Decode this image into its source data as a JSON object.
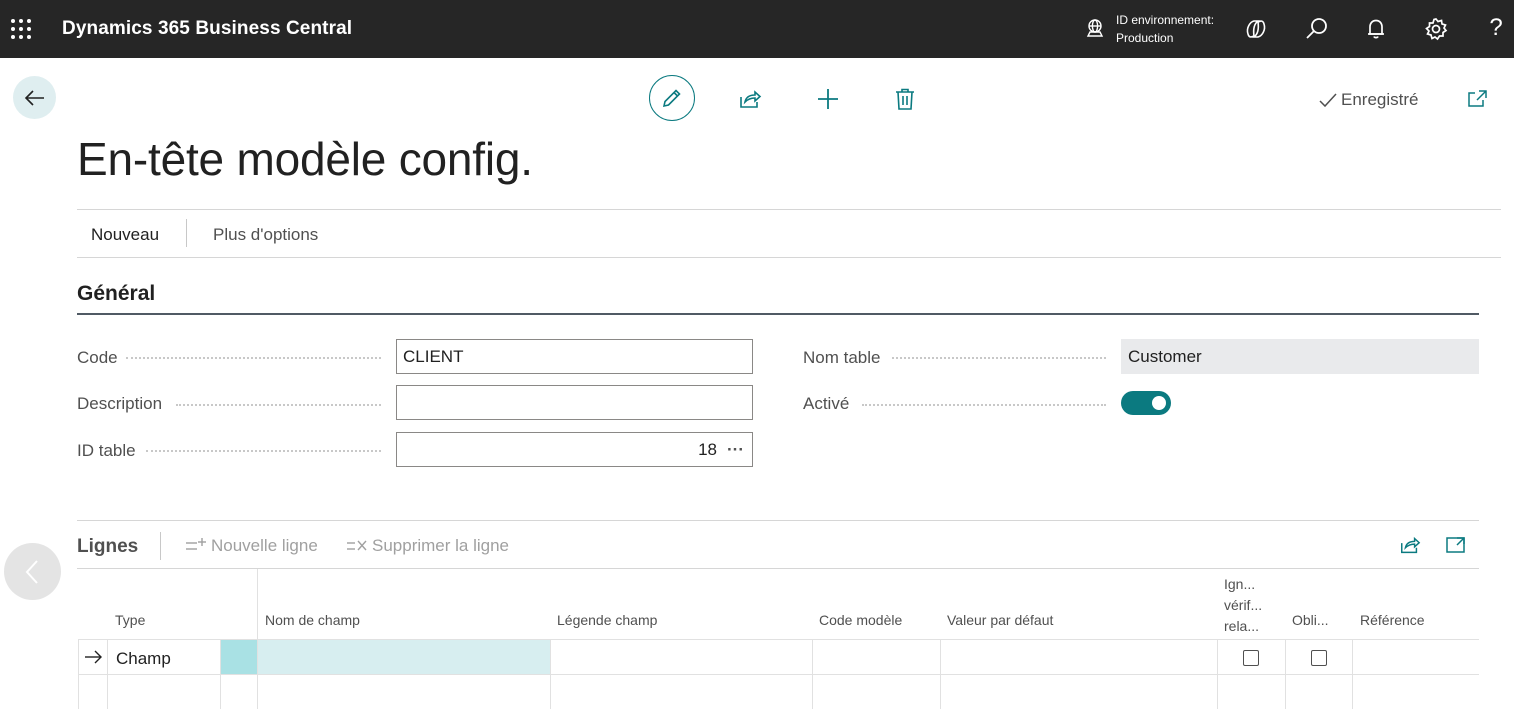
{
  "topbar": {
    "app_title": "Dynamics 365 Business Central",
    "environment_label": "ID environnement:",
    "environment_value": "Production",
    "icons": [
      "waffle-icon",
      "environment-icon",
      "copilot-icon",
      "search-icon",
      "bell-icon",
      "gear-icon",
      "help-icon"
    ],
    "help_label": "?"
  },
  "commands": {
    "icons": [
      "back-arrow-icon",
      "edit-pencil-icon",
      "share-icon",
      "add-icon",
      "delete-icon",
      "open-new-window-icon"
    ],
    "saved_label": "Enregistré"
  },
  "page": {
    "title": "En-tête modèle config."
  },
  "actionbar": {
    "new_label": "Nouveau",
    "more_label": "Plus d'options"
  },
  "general": {
    "section_title": "Général",
    "code_label": "Code",
    "code_value": "CLIENT",
    "description_label": "Description",
    "description_value": "",
    "table_id_label": "ID table",
    "table_id_value": "18",
    "lookup_label": "···",
    "table_name_label": "Nom table",
    "table_name_value": "Customer",
    "enabled_label": "Activé",
    "enabled_value": true
  },
  "lines": {
    "title": "Lignes",
    "new_line_label": "Nouvelle ligne",
    "delete_line_label": "Supprimer la ligne",
    "columns": {
      "type": "Type",
      "field_name": "Nom de champ",
      "field_caption": "Légende champ",
      "template_code": "Code modèle",
      "default_value": "Valeur par défaut",
      "skip_relation_check_1": "Ign...",
      "skip_relation_check_2": "vérif...",
      "skip_relation_check_3": "rela...",
      "mandatory": "Obli...",
      "reference": "Référence"
    },
    "rows": [
      {
        "type": "Champ",
        "field_name": "",
        "field_caption": "",
        "template_code": "",
        "default_value": "",
        "skip_relation_check": false,
        "mandatory": false,
        "reference": ""
      }
    ]
  },
  "colors": {
    "topbar_bg": "#262626",
    "accent": "#0b7a80",
    "selected_cell": "#a9e1e4",
    "highlight_cell": "#d7eef0"
  }
}
